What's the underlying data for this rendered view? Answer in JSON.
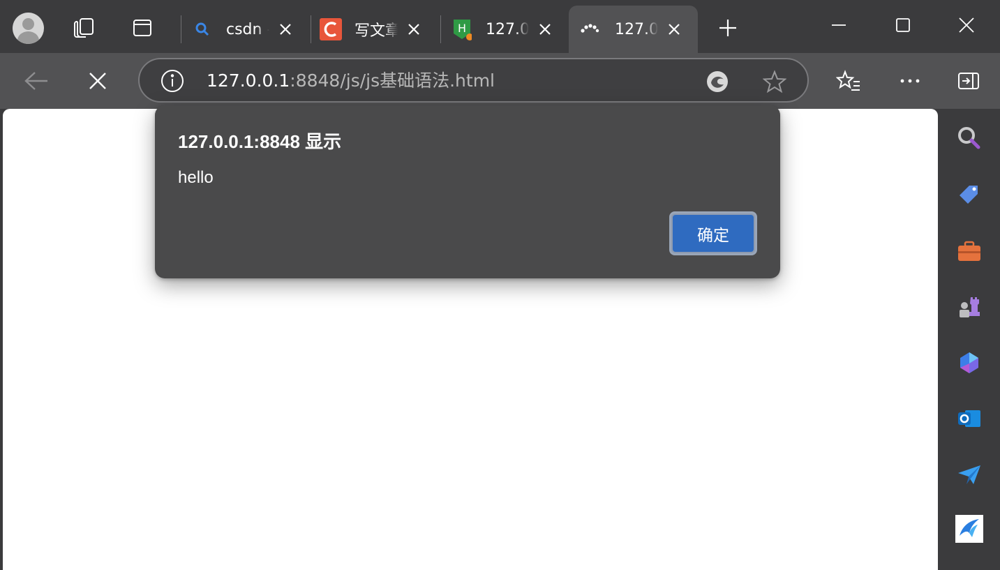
{
  "tabs": [
    {
      "title": "csdn -",
      "favicon": "search-icon",
      "active": false
    },
    {
      "title": "写文章",
      "favicon": "csdn-c-logo",
      "active": false
    },
    {
      "title": "127.0.",
      "favicon": "hbuilder-h-logo",
      "active": false
    },
    {
      "title": "127.0.",
      "favicon": "loading-spinner-icon",
      "active": true
    }
  ],
  "address_bar": {
    "host": "127.0.0.1",
    "path": ":8848/js/js基础语法.html"
  },
  "dialog": {
    "title": "127.0.0.1:8848 显示",
    "message": "hello",
    "ok_label": "确定"
  },
  "sidebar": {
    "items": [
      "search-icon",
      "shopping-tag-icon",
      "tools-briefcase-icon",
      "games-icon",
      "copilot-icon",
      "outlook-icon",
      "send-icon",
      "app-logo-icon"
    ]
  },
  "colors": {
    "frame": "#3b3b3d",
    "toolbar": "#525254",
    "dialog": "#4a4a4b",
    "ok_button": "#2f6bc0"
  }
}
